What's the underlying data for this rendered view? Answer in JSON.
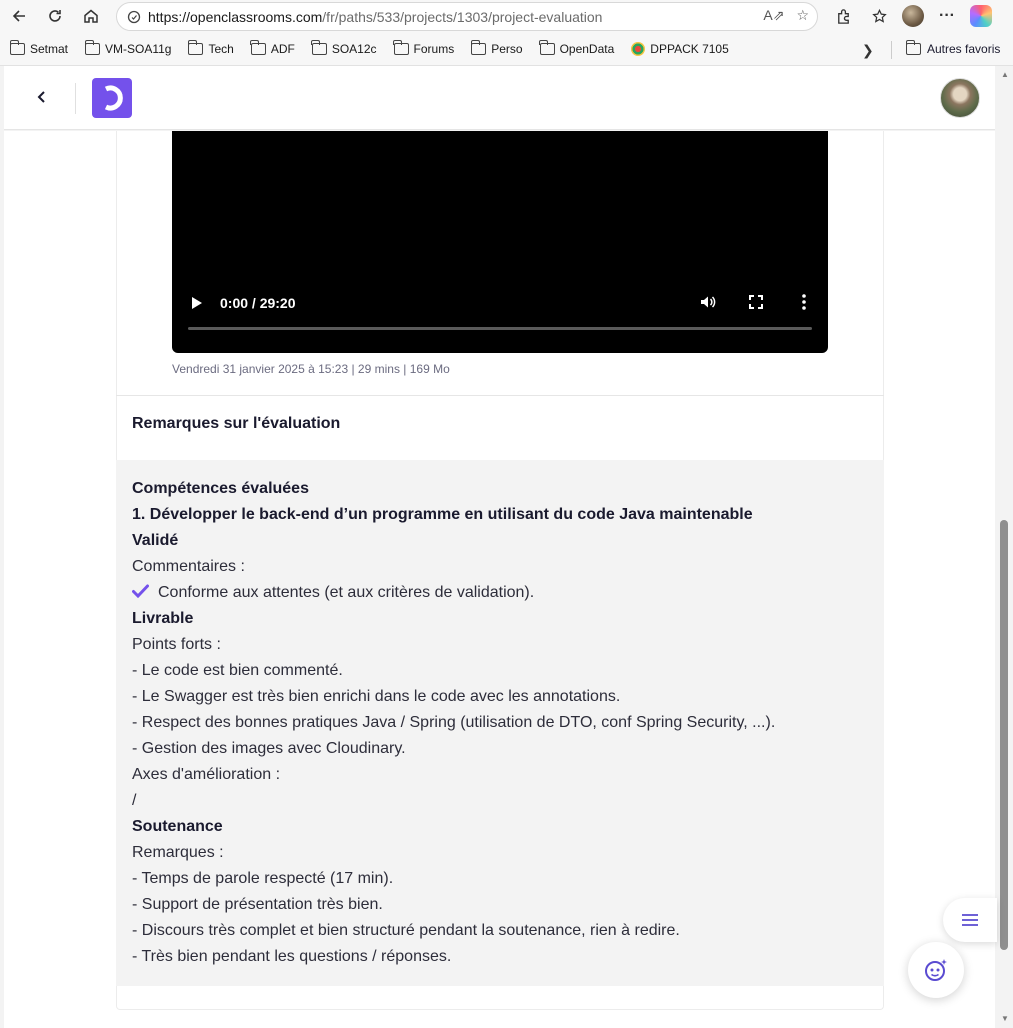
{
  "browser": {
    "url_host": "https://openclassrooms.com",
    "url_path": "/fr/paths/533/projects/1303/project-evaluation"
  },
  "bookmarks": {
    "items": [
      "Setmat",
      "VM-SOA11g",
      "Tech",
      "ADF",
      "SOA12c",
      "Forums",
      "Perso",
      "OpenData",
      "DPPACK 7105"
    ],
    "other": "Autres favoris"
  },
  "video": {
    "time": "0:00 / 29:20",
    "meta": "Vendredi 31 janvier 2025 à 15:23 | 29 mins | 169 Mo"
  },
  "section": {
    "title": "Remarques sur l'évaluation"
  },
  "evaluation": {
    "lines": [
      {
        "text": "Compétences évaluées",
        "style": "b"
      },
      {
        "text": "1. Développer le back-end d’un programme en utilisant du code Java maintenable",
        "style": "b"
      },
      {
        "text": "Validé",
        "style": "b"
      },
      {
        "text": "Commentaires :",
        "style": "n"
      },
      {
        "text": "Conforme aux attentes (et aux critères de validation).",
        "style": "n",
        "check": true
      },
      {
        "text": "Livrable",
        "style": "b"
      },
      {
        "text": "Points forts :",
        "style": "n"
      },
      {
        "text": "- Le code est bien commenté.",
        "style": "n"
      },
      {
        "text": "- Le Swagger est très bien enrichi dans le code avec les annotations.",
        "style": "n"
      },
      {
        "text": "- Respect des bonnes pratiques Java / Spring (utilisation de DTO, conf Spring Security, ...).",
        "style": "n"
      },
      {
        "text": "- Gestion des images avec Cloudinary.",
        "style": "n"
      },
      {
        "text": "Axes d'amélioration :",
        "style": "n"
      },
      {
        "text": "/",
        "style": "n"
      },
      {
        "text": "Soutenance",
        "style": "b"
      },
      {
        "text": "Remarques :",
        "style": "n"
      },
      {
        "text": "- Temps de parole respecté (17 min).",
        "style": "n"
      },
      {
        "text": "- Support de présentation très bien.",
        "style": "n"
      },
      {
        "text": "- Discours très complet et bien structuré pendant la soutenance, rien à redire.",
        "style": "n"
      },
      {
        "text": "- Très bien pendant les questions / réponses.",
        "style": "n"
      }
    ]
  },
  "colors": {
    "brand": "#7451eb",
    "text": "#1a1a2e",
    "panel": "#f3f3f3"
  }
}
